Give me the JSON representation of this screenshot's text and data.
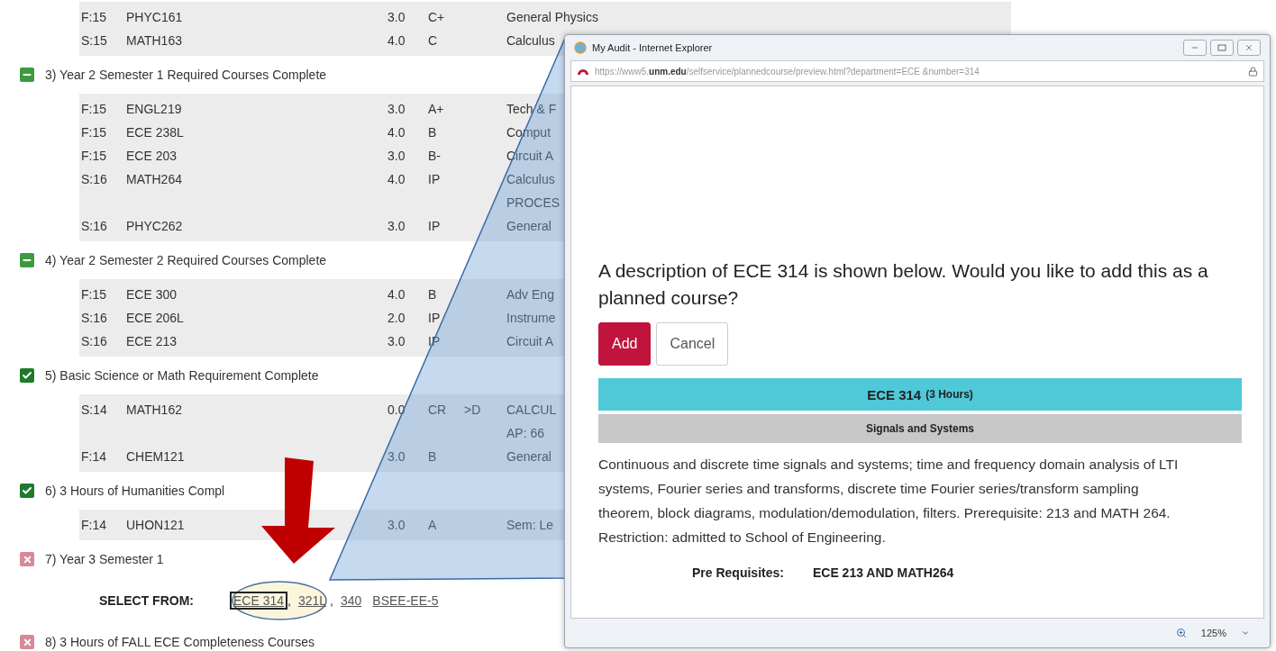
{
  "audit": {
    "top_rows": [
      {
        "term": "F:15",
        "course": "PHYC161",
        "credits": "3.0",
        "grade": "C+",
        "description": [
          "General Physics"
        ]
      },
      {
        "term": "S:15",
        "course": "MATH163",
        "credits": "4.0",
        "grade": "C",
        "description": [
          "Calculus"
        ]
      }
    ],
    "sections": [
      {
        "kind": "in_progress",
        "title": "3) Year 2 Semester 1 Required Courses Complete",
        "rows": [
          {
            "term": "F:15",
            "course": "ENGL219",
            "credits": "3.0",
            "grade": "A+",
            "description": [
              "Tech & F"
            ]
          },
          {
            "term": "F:15",
            "course": "ECE 238L",
            "credits": "4.0",
            "grade": "B",
            "description": [
              "Comput"
            ]
          },
          {
            "term": "F:15",
            "course": "ECE 203",
            "credits": "3.0",
            "grade": "B-",
            "description": [
              "Circuit A"
            ]
          },
          {
            "term": "S:16",
            "course": "MATH264",
            "credits": "4.0",
            "grade": "IP",
            "description": [
              "Calculus",
              "PROCES"
            ]
          },
          {
            "term": "S:16",
            "course": "PHYC262",
            "credits": "3.0",
            "grade": "IP",
            "description": [
              "General"
            ]
          }
        ]
      },
      {
        "kind": "in_progress",
        "title": "4) Year 2 Semester 2 Required Courses Complete",
        "rows": [
          {
            "term": "F:15",
            "course": "ECE 300",
            "credits": "4.0",
            "grade": "B",
            "description": [
              "Adv Eng"
            ]
          },
          {
            "term": "S:16",
            "course": "ECE 206L",
            "credits": "2.0",
            "grade": "IP",
            "description": [
              "Instrume"
            ]
          },
          {
            "term": "S:16",
            "course": "ECE 213",
            "credits": "3.0",
            "grade": "IP",
            "description": [
              "Circuit A"
            ]
          }
        ]
      },
      {
        "kind": "complete",
        "title": "5) Basic Science or Math Requirement Complete",
        "rows": [
          {
            "term": "S:14",
            "course": "MATH162",
            "credits": "0.0",
            "grade": "CR",
            "note": ">D",
            "description": [
              "CALCUL",
              "AP: 66"
            ]
          },
          {
            "term": "F:14",
            "course": "CHEM121",
            "credits": "3.0",
            "grade": "B",
            "description": [
              "General"
            ]
          }
        ]
      },
      {
        "kind": "complete",
        "title": "6) 3 Hours of Humanities Compl",
        "rows": [
          {
            "term": "F:14",
            "course": "UHON121",
            "credits": "3.0",
            "grade": "A",
            "description": [
              "Sem: Le"
            ]
          }
        ]
      },
      {
        "kind": "incomplete",
        "title": "7) Year 3 Semester 1",
        "select_label": "SELECT FROM:",
        "options": [
          {
            "text": "ECE 314",
            "selected": true,
            "after": ","
          },
          {
            "text": "321L",
            "selected": false,
            "after": ","
          },
          {
            "text": "340",
            "selected": false
          },
          {
            "text": "BSEE-EE-5",
            "selected": false
          }
        ]
      },
      {
        "kind": "incomplete",
        "title": "8) 3 Hours of FALL ECE Completeness Courses"
      }
    ]
  },
  "popup": {
    "title": "My Audit - Internet Explorer",
    "address": "https://www5.**unm.edu**/selfservice/plannedcourse/preview.html?department=ECE &number=314",
    "question": "A description of ECE 314 is shown below. Would you like to add this as a planned course?",
    "buttons": [
      {
        "label": "Add",
        "kind": "primary"
      },
      {
        "label": "Cancel",
        "kind": "secondary"
      }
    ],
    "course": "ECE 314",
    "hours": "(3 Hours)",
    "course_title": "Signals and Systems",
    "description": "Continuous and discrete time signals and systems; time and frequency domain analysis of LTI systems, Fourier series and transforms, discrete time Fourier series/transform sampling theorem, block diagrams, modulation/demodulation, filters. Prerequisite: 213 and MATH 264. Restriction: admitted to School of Engineering.",
    "prereq_label": "Pre Requisites:",
    "prereq_value": "ECE 213 AND MATH264",
    "zoom": "125%"
  }
}
